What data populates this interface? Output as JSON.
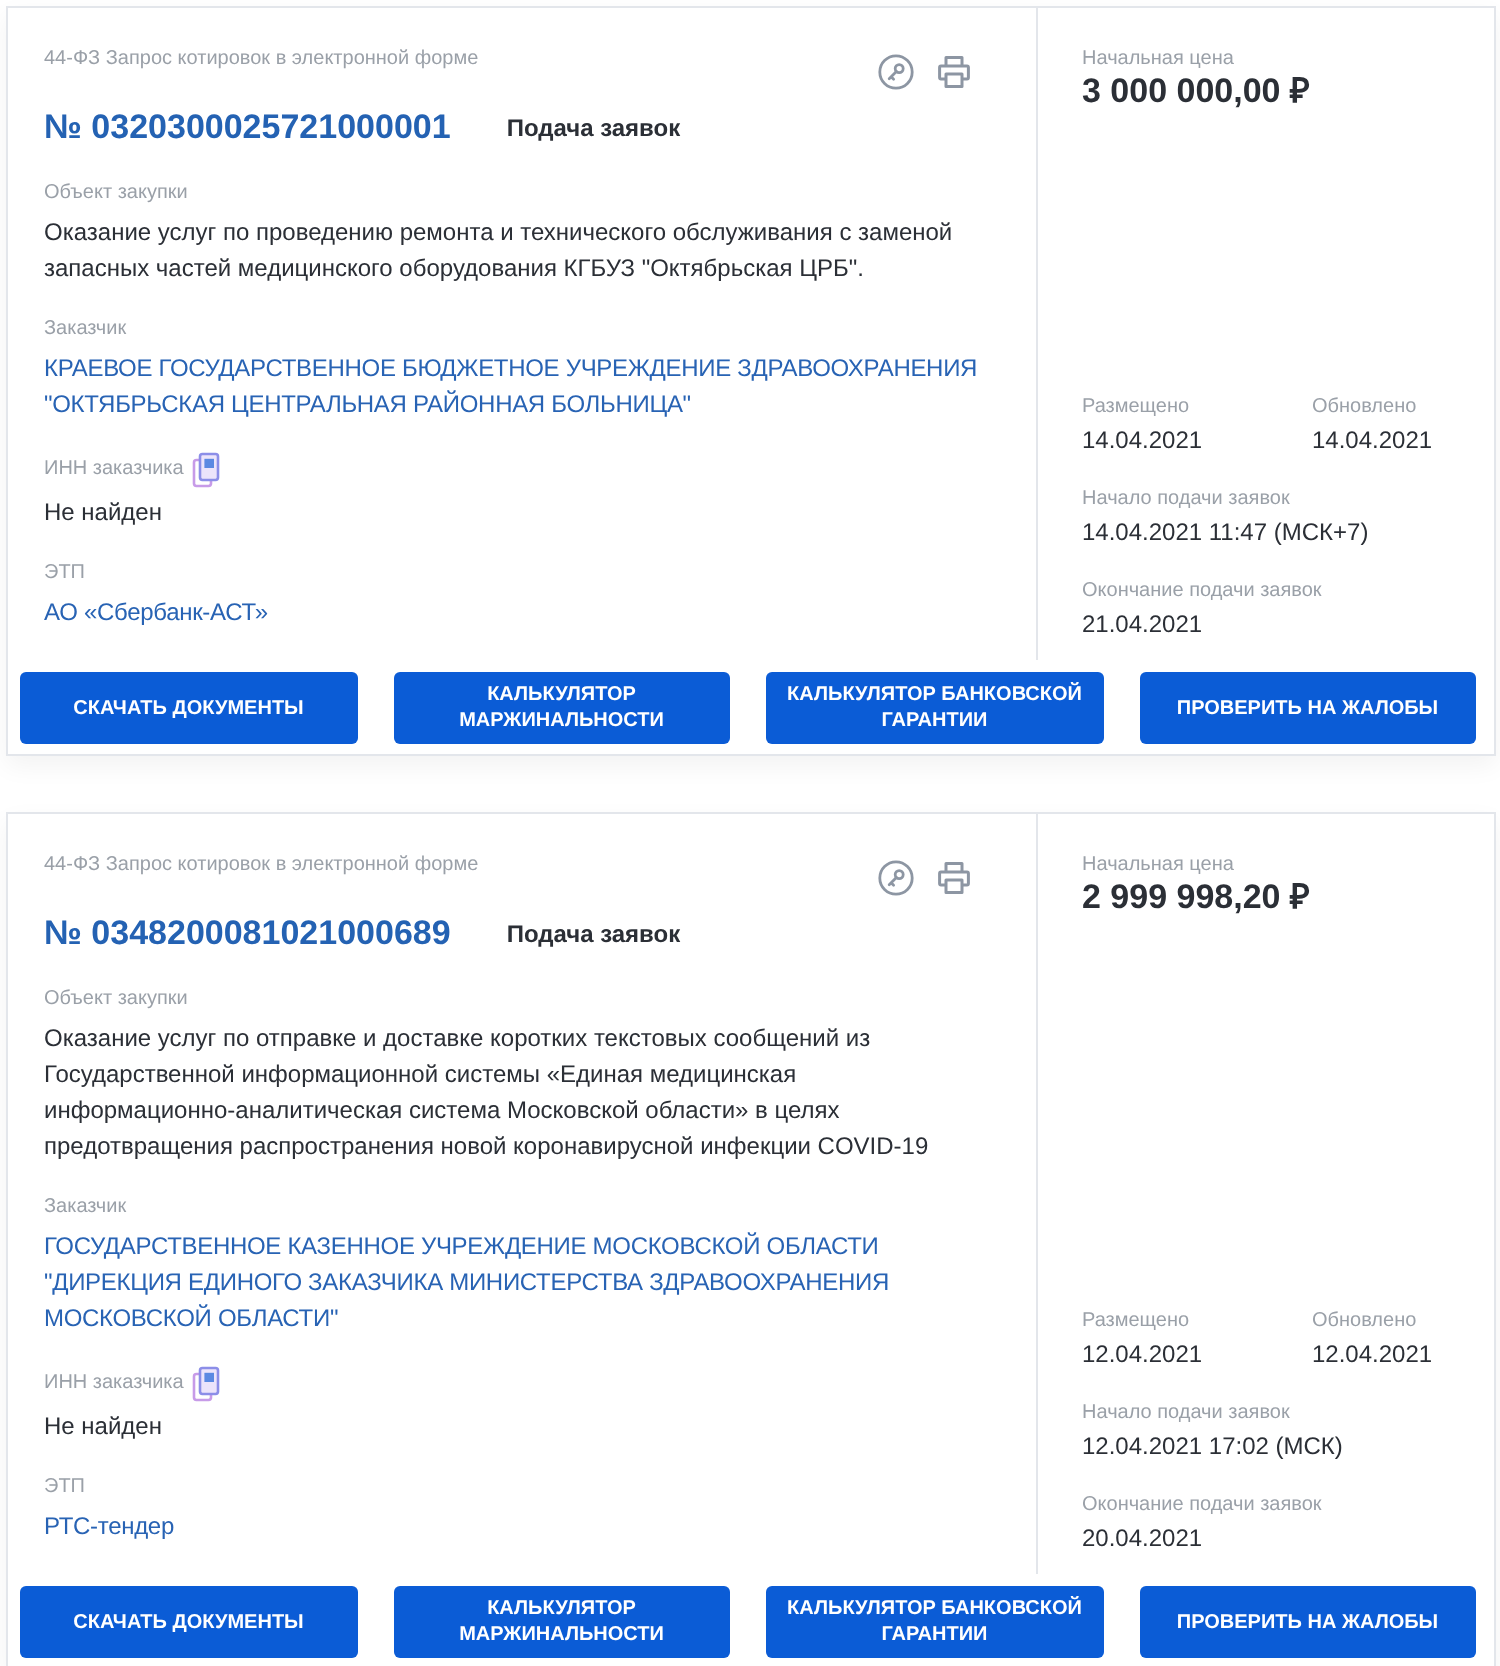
{
  "cards": [
    {
      "procedure": "44-ФЗ Запрос котировок в электронной форме",
      "number": "№ 0320300025721000001",
      "status": "Подача заявок",
      "fields": [
        {
          "kind": "text",
          "label": "Объект закупки",
          "value": "Оказание услуг по проведению ремонта и технического обслуживания с заменой запасных частей медицинского оборудования КГБУЗ \"Октябрьская ЦРБ\"."
        },
        {
          "kind": "link",
          "label": "Заказчик",
          "value": "КРАЕВОЕ ГОСУДАРСТВЕННОЕ БЮДЖЕТНОЕ УЧРЕЖДЕНИЕ ЗДРАВООХРАНЕНИЯ \"ОКТЯБРЬСКАЯ ЦЕНТРАЛЬНАЯ РАЙОННАЯ БОЛЬНИЦА\""
        },
        {
          "kind": "copyable",
          "label": "ИНН заказчика",
          "value": "Не найден"
        },
        {
          "kind": "link",
          "label": "ЭТП",
          "value": "АО «Сбербанк-АСТ»"
        }
      ],
      "price": {
        "label": "Начальная цена",
        "value": "3 000 000,00 ₽"
      },
      "date_rows": [
        [
          {
            "label": "Размещено",
            "value": "14.04.2021"
          },
          {
            "label": "Обновлено",
            "value": "14.04.2021"
          }
        ],
        [
          {
            "label": "Начало подачи заявок",
            "value": "14.04.2021 11:47 (МСК+7)"
          }
        ],
        [
          {
            "label": "Окончание подачи заявок",
            "value": "21.04.2021"
          }
        ]
      ],
      "buttons": [
        "СКАЧАТЬ ДОКУМЕНТЫ",
        "КАЛЬКУЛЯТОР МАРЖИНАЛЬНОСТИ",
        "КАЛЬКУЛЯТОР БАНКОВСКОЙ ГАРАНТИИ",
        "ПРОВЕРИТЬ НА ЖАЛОБЫ"
      ]
    },
    {
      "procedure": "44-ФЗ Запрос котировок в электронной форме",
      "number": "№ 0348200081021000689",
      "status": "Подача заявок",
      "fields": [
        {
          "kind": "text",
          "label": "Объект закупки",
          "value": "Оказание услуг по отправке и доставке коротких текстовых сообщений из Государственной информационной системы «Единая медицинская информационно-аналитическая система Московской области» в целях предотвращения распространения новой коронавирусной инфекции COVID-19"
        },
        {
          "kind": "link",
          "label": "Заказчик",
          "value": "ГОСУДАРСТВЕННОЕ КАЗЕННОЕ УЧРЕЖДЕНИЕ МОСКОВСКОЙ ОБЛАСТИ \"ДИРЕКЦИЯ ЕДИНОГО ЗАКАЗЧИКА МИНИСТЕРСТВА ЗДРАВООХРАНЕНИЯ МОСКОВСКОЙ ОБЛАСТИ\""
        },
        {
          "kind": "copyable",
          "label": "ИНН заказчика",
          "value": "Не найден"
        },
        {
          "kind": "link",
          "label": "ЭТП",
          "value": "РТС-тендер"
        }
      ],
      "price": {
        "label": "Начальная цена",
        "value": "2 999 998,20 ₽"
      },
      "date_rows": [
        [
          {
            "label": "Размещено",
            "value": "12.04.2021"
          },
          {
            "label": "Обновлено",
            "value": "12.04.2021"
          }
        ],
        [
          {
            "label": "Начало подачи заявок",
            "value": "12.04.2021 17:02 (МСК)"
          }
        ],
        [
          {
            "label": "Окончание подачи заявок",
            "value": "20.04.2021"
          }
        ]
      ],
      "buttons": [
        "СКАЧАТЬ ДОКУМЕНТЫ",
        "КАЛЬКУЛЯТОР МАРЖИНАЛЬНОСТИ",
        "КАЛЬКУЛЯТОР БАНКОВСКОЙ ГАРАНТИИ",
        "ПРОВЕРИТЬ НА ЖАЛОБЫ"
      ]
    }
  ]
}
